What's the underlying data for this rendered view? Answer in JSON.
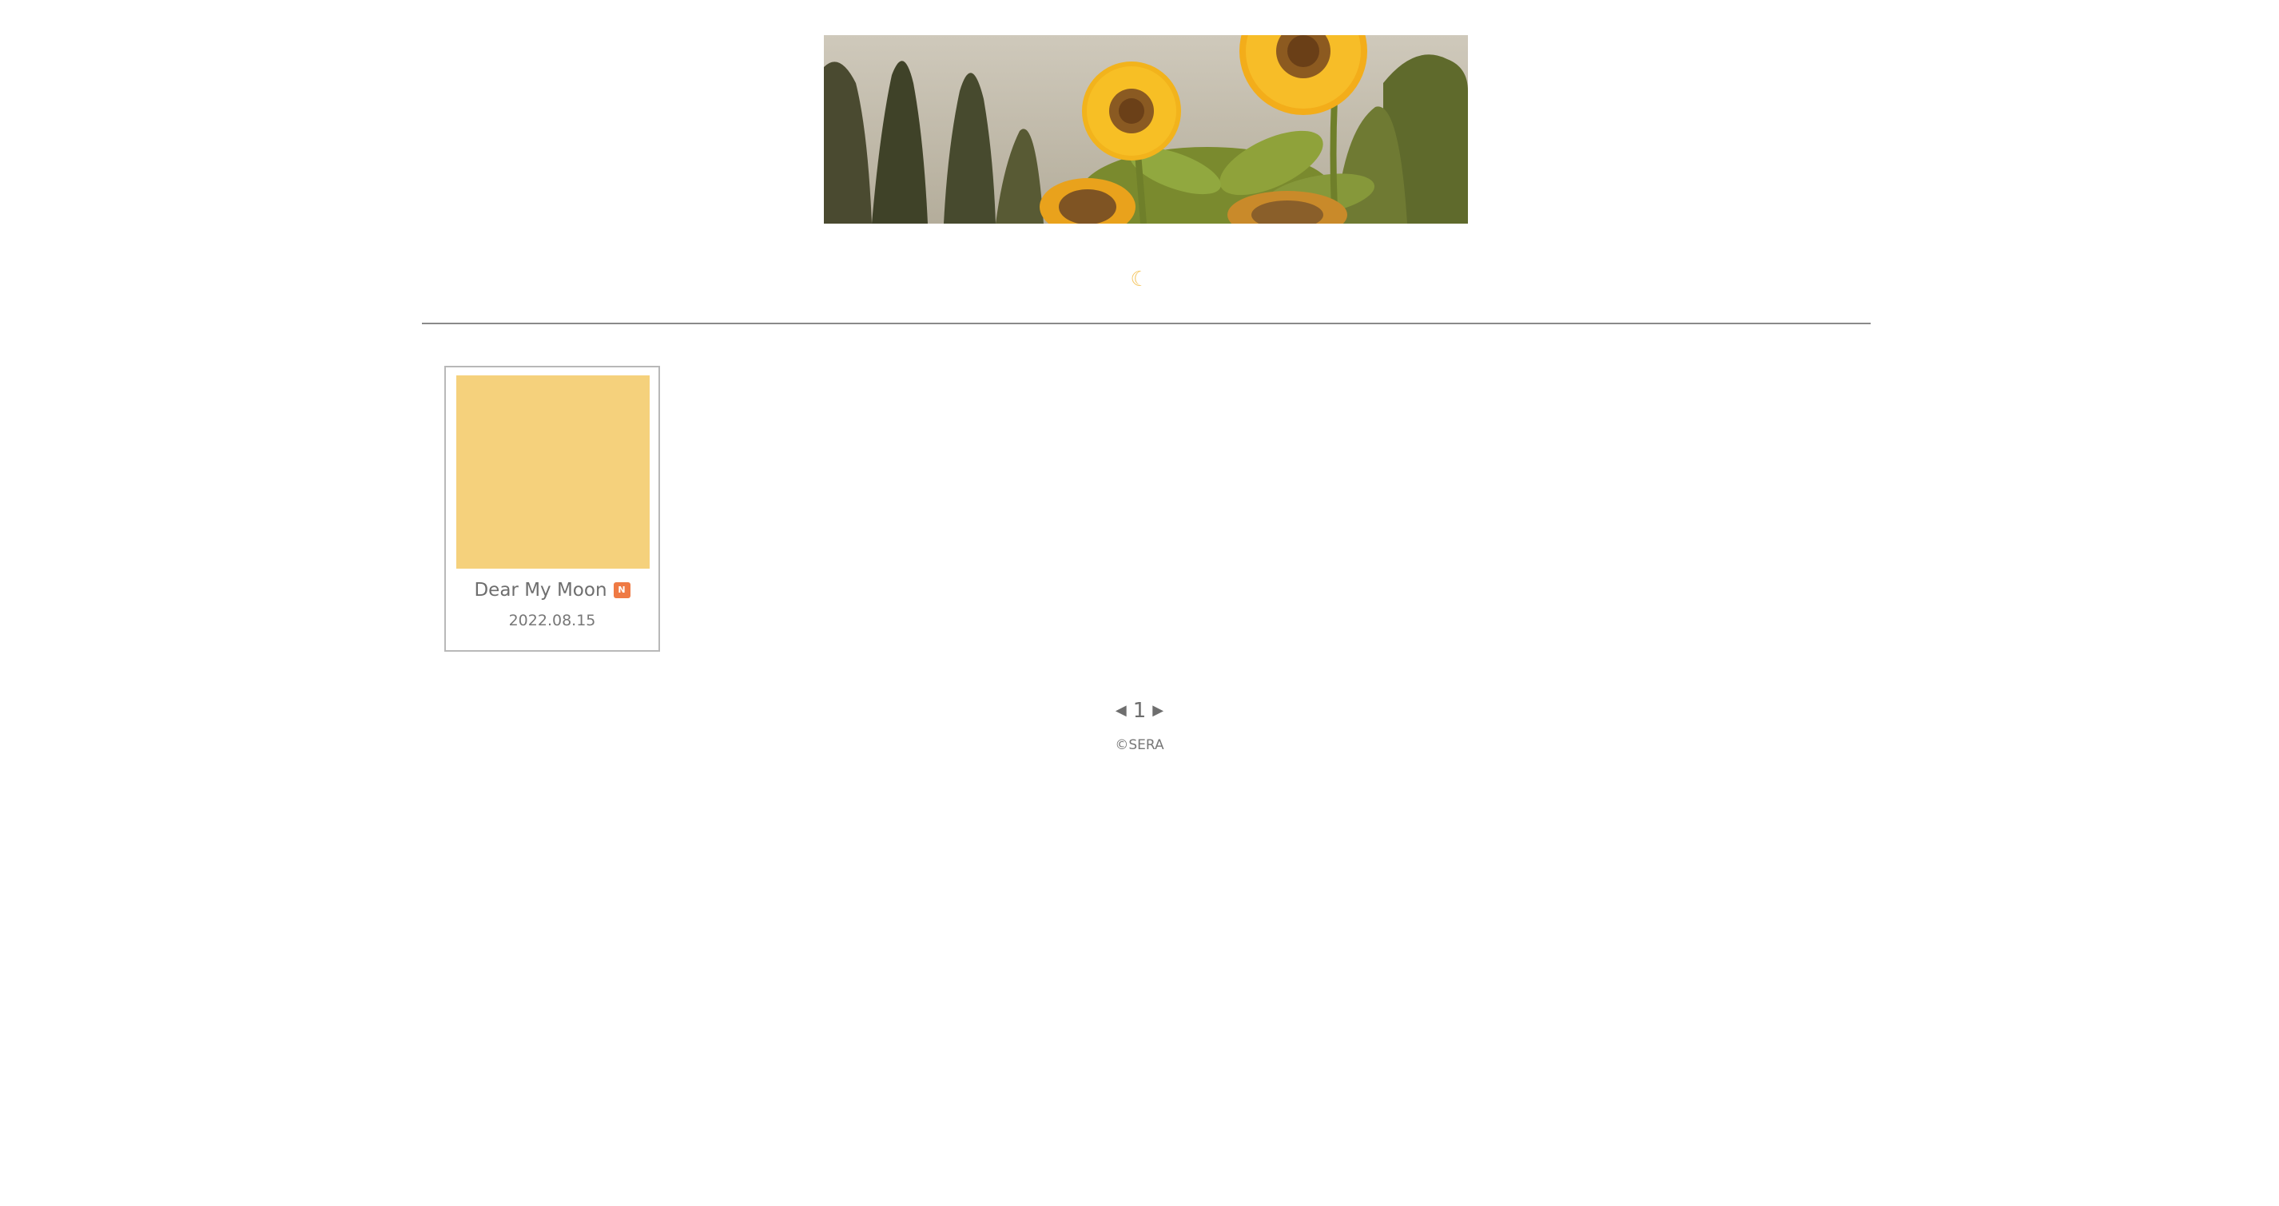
{
  "header": {
    "banner_image": "sunflower-field-banner",
    "moon_symbol": "☾",
    "moon_color": "#f5c660"
  },
  "posts": [
    {
      "title": "Dear My Moon",
      "badge": "N",
      "date": "2022.08.15",
      "thumb_color": "#f5d17c",
      "badge_color": "#ef7a44"
    }
  ],
  "pagination": {
    "prev_icon": "◀",
    "current": "1",
    "next_icon": "▶"
  },
  "footer": {
    "copyright": "©SERA"
  }
}
